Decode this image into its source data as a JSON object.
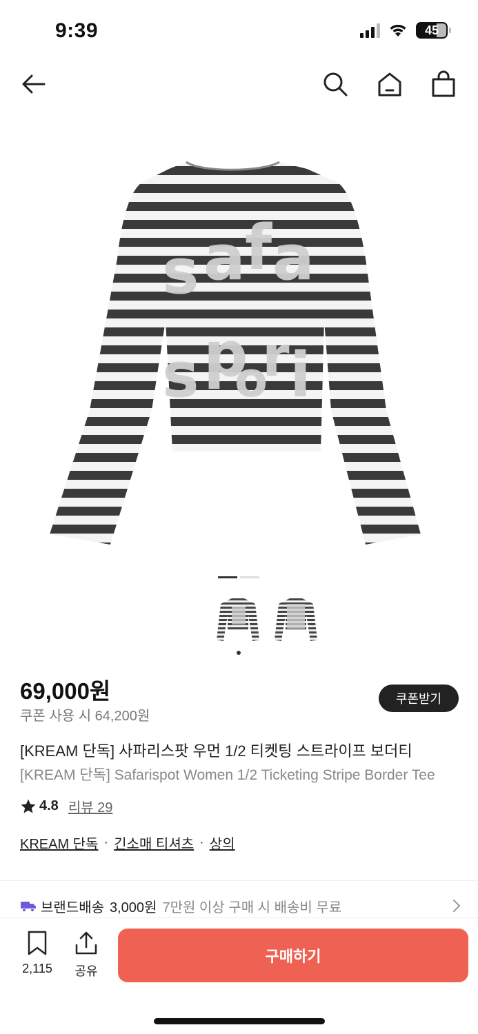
{
  "status_bar": {
    "time": "9:39",
    "battery": "45"
  },
  "nav": {
    "back_icon": "arrow-left-icon",
    "search_icon": "search-icon",
    "home_icon": "home-icon",
    "cart_icon": "shopping-bag-icon"
  },
  "product": {
    "image_alt": "striped long sleeve tee with safari spot lettering",
    "pager_count": 2,
    "pager_active": 0,
    "price": "69,000원",
    "coupon_price": "쿠폰 사용 시 64,200원",
    "coupon_button": "쿠폰받기",
    "name_ko": "[KREAM 단독] 사파리스팟 우먼 1/2 티켓팅 스트라이프 보더티",
    "name_en": "[KREAM 단독] Safarispot Women 1/2 Ticketing Stripe Border Tee",
    "rating": "4.8",
    "review_label": "리뷰 29",
    "categories": [
      "KREAM 단독",
      "긴소매 티셔츠",
      "상의"
    ]
  },
  "shipping": {
    "label": "브랜드배송",
    "price": "3,000원",
    "note": "7만원 이상 구매 시 배송비 무료"
  },
  "bottom_bar": {
    "bookmark_count": "2,115",
    "share_label": "공유",
    "buy_label": "구매하기"
  },
  "colors": {
    "buy_button": "#ef6253",
    "shipping_icon": "#6b5bd8"
  }
}
